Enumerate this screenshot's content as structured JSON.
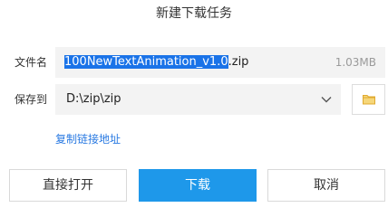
{
  "dialog": {
    "title": "新建下载任务"
  },
  "filename": {
    "label": "文件名",
    "selected_part": "100NewTextAnimation_v1.0",
    "extension": ".zip",
    "size": "1.03MB"
  },
  "save_to": {
    "label": "保存到",
    "path": "D:\\zip\\zip"
  },
  "copy_link": {
    "label": "复制链接地址"
  },
  "buttons": {
    "open_label": "直接打开",
    "download_label": "下载",
    "cancel_label": "取消"
  },
  "colors": {
    "accent": "#1e98ea",
    "link": "#2a7ae2",
    "selection": "#1a73e8",
    "folder": "#f0c24a"
  },
  "icons": {
    "dropdown": "chevron-down-icon",
    "folder": "folder-icon"
  }
}
